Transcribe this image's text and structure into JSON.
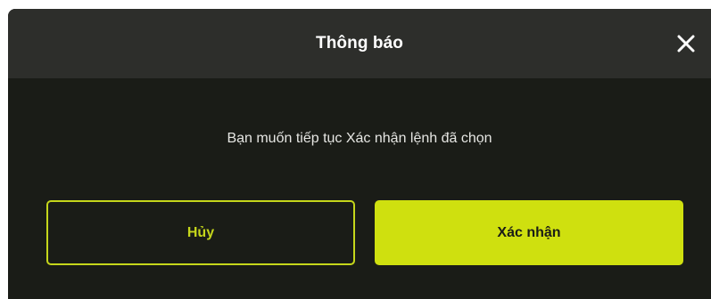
{
  "dialog": {
    "title": "Thông báo",
    "close_icon": "close-icon",
    "message": "Bạn muốn tiếp tục Xác nhận lệnh đã chọn",
    "cancel_label": "Hủy",
    "confirm_label": "Xác nhận"
  },
  "colors": {
    "header_bg": "#2d2e2b",
    "body_bg": "#1a1c17",
    "accent": "#cfe00f"
  }
}
